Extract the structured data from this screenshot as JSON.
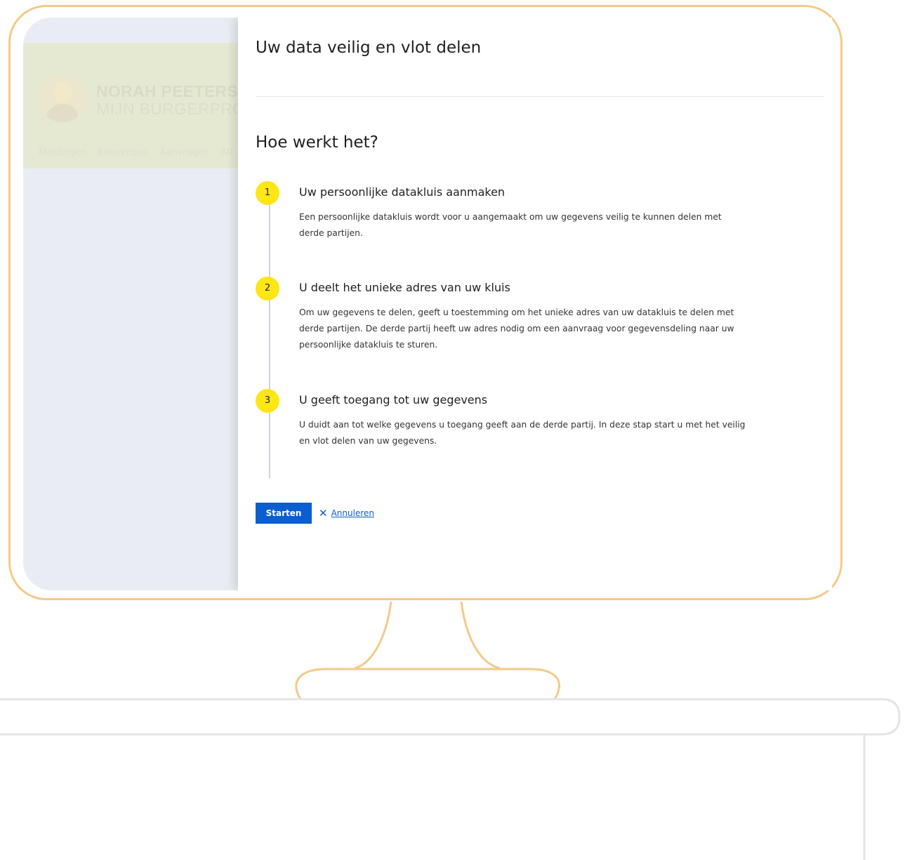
{
  "background_app": {
    "user_name": "NORAH PEETERS",
    "profile_label": "MIJN BURGERPROF",
    "nav_items": [
      "Meldingen",
      "Brievenbus",
      "Aanvragen",
      "Att"
    ]
  },
  "modal": {
    "title": "Uw data veilig en vlot delen",
    "section_title": "Hoe werkt het?",
    "steps": [
      {
        "number": "1",
        "title": "Uw persoonlijke datakluis aanmaken",
        "description": "Een persoonlijke datakluis wordt voor u aangemaakt om uw gegevens veilig te kunnen delen met derde partijen."
      },
      {
        "number": "2",
        "title": "U deelt het unieke adres van uw kluis",
        "description": "Om uw gegevens te delen, geeft u toestemming om het unieke adres van uw datakluis te delen met derde partijen. De derde partij heeft uw adres nodig om een aanvraag voor gegevensdeling naar uw persoonlijke datakluis te sturen."
      },
      {
        "number": "3",
        "title": "U geeft toegang tot uw gegevens",
        "description": "U duidt aan tot welke gegevens u toegang geeft aan de derde partij. In deze stap start u met het veilig en vlot delen van uw gegevens."
      }
    ],
    "start_label": "Starten",
    "cancel_label": "Annuleren"
  },
  "colors": {
    "frame": "#f6c989",
    "primary": "#0a5ecf",
    "step_badge": "#ffe615"
  },
  "icons": {
    "cancel": "close-icon",
    "avatar": "user-avatar"
  }
}
